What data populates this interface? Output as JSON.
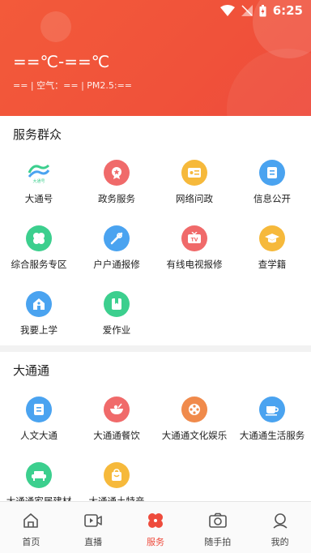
{
  "status_bar": {
    "time": "6:25"
  },
  "weather": {
    "temperature": "==℃-==℃",
    "details": "== | 空气：== | PM2.5:=="
  },
  "sections": [
    {
      "title": "服务群众",
      "items": [
        {
          "label": "大通号",
          "icon": "datong-logo-icon",
          "color": "#ffffff"
        },
        {
          "label": "政务服务",
          "icon": "star-badge-icon",
          "color": "#f06a6a"
        },
        {
          "label": "网络问政",
          "icon": "ticket-icon",
          "color": "#f6b93b"
        },
        {
          "label": "信息公开",
          "icon": "document-icon",
          "color": "#4aa3f0"
        },
        {
          "label": "综合服务专区",
          "icon": "clover-icon",
          "color": "#3ccf8e"
        },
        {
          "label": "户户通报修",
          "icon": "wrench-icon",
          "color": "#4aa3f0"
        },
        {
          "label": "有线电视报修",
          "icon": "tv-icon",
          "color": "#f06a6a"
        },
        {
          "label": "查学籍",
          "icon": "graduation-cap-icon",
          "color": "#f6b93b"
        },
        {
          "label": "我要上学",
          "icon": "school-icon",
          "color": "#4aa3f0"
        },
        {
          "label": "爱作业",
          "icon": "bookmark-book-icon",
          "color": "#3ccf8e"
        }
      ]
    },
    {
      "title": "大通通",
      "items": [
        {
          "label": "人文大通",
          "icon": "document-icon",
          "color": "#4aa3f0"
        },
        {
          "label": "大通通餐饮",
          "icon": "bowl-icon",
          "color": "#f06a6a"
        },
        {
          "label": "大通通文化娱乐",
          "icon": "film-reel-icon",
          "color": "#f08a4b"
        },
        {
          "label": "大通通生活服务",
          "icon": "coffee-cup-icon",
          "color": "#4aa3f0"
        },
        {
          "label": "大通通家居建材",
          "icon": "sofa-icon",
          "color": "#3ccf8e"
        },
        {
          "label": "大通通土特产",
          "icon": "shopping-bag-icon",
          "color": "#f6b93b"
        }
      ]
    }
  ],
  "tabs": [
    {
      "label": "首页",
      "icon": "home-icon"
    },
    {
      "label": "直播",
      "icon": "video-icon"
    },
    {
      "label": "服务",
      "icon": "services-icon",
      "active": true
    },
    {
      "label": "随手拍",
      "icon": "camera-icon"
    },
    {
      "label": "我的",
      "icon": "profile-icon"
    }
  ],
  "colors": {
    "accent": "#ee4b3c",
    "header": "#f0523a"
  }
}
